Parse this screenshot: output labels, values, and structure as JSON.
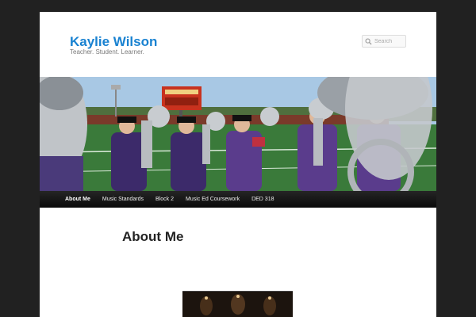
{
  "site": {
    "title": "Kaylie Wilson",
    "description": "Teacher. Student. Learner."
  },
  "search": {
    "placeholder": "Search",
    "icon": "search-icon"
  },
  "banner": {
    "scoreboard_color": "#c8321e",
    "uniform_color": "#5a3c8c",
    "field_color": "#3a7a3a"
  },
  "nav": {
    "items": [
      {
        "label": "About Me",
        "active": true
      },
      {
        "label": "Music Standards"
      },
      {
        "label": "Block 2"
      },
      {
        "label": "Music Ed Coursework"
      },
      {
        "label": "DED 318"
      }
    ]
  },
  "page": {
    "title": "About Me"
  },
  "colors": {
    "accent": "#1982d1",
    "background": "#212121",
    "nav_background": "#111111"
  }
}
